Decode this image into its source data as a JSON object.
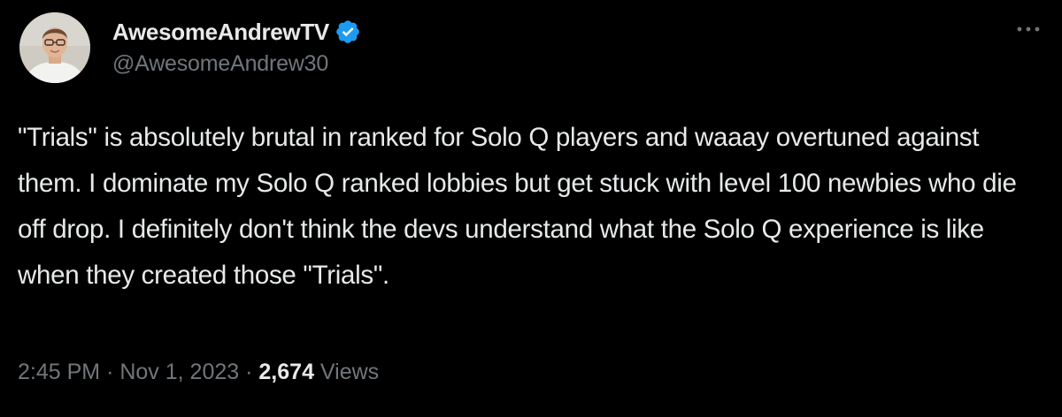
{
  "author": {
    "display_name": "AwesomeAndrewTV",
    "handle": "@AwesomeAndrew30",
    "verified": true,
    "avatar_icon": "profile-photo"
  },
  "more_icon": "more-horizontal-icon",
  "tweet": {
    "text": "\"Trials\" is absolutely brutal in ranked for Solo Q players and waaay overtuned against them. I dominate my Solo Q ranked lobbies but get stuck with level 100 newbies who die off drop. I definitely don't think the devs understand what the Solo Q experience is like when they created those \"Trials\"."
  },
  "meta": {
    "time": "2:45 PM",
    "separator": "·",
    "date": "Nov 1, 2023",
    "views_count": "2,674",
    "views_label": "Views"
  },
  "colors": {
    "background": "#000000",
    "primary_text": "#e7e9ea",
    "secondary_text": "#71767b",
    "verified_badge": "#1d9bf0"
  }
}
